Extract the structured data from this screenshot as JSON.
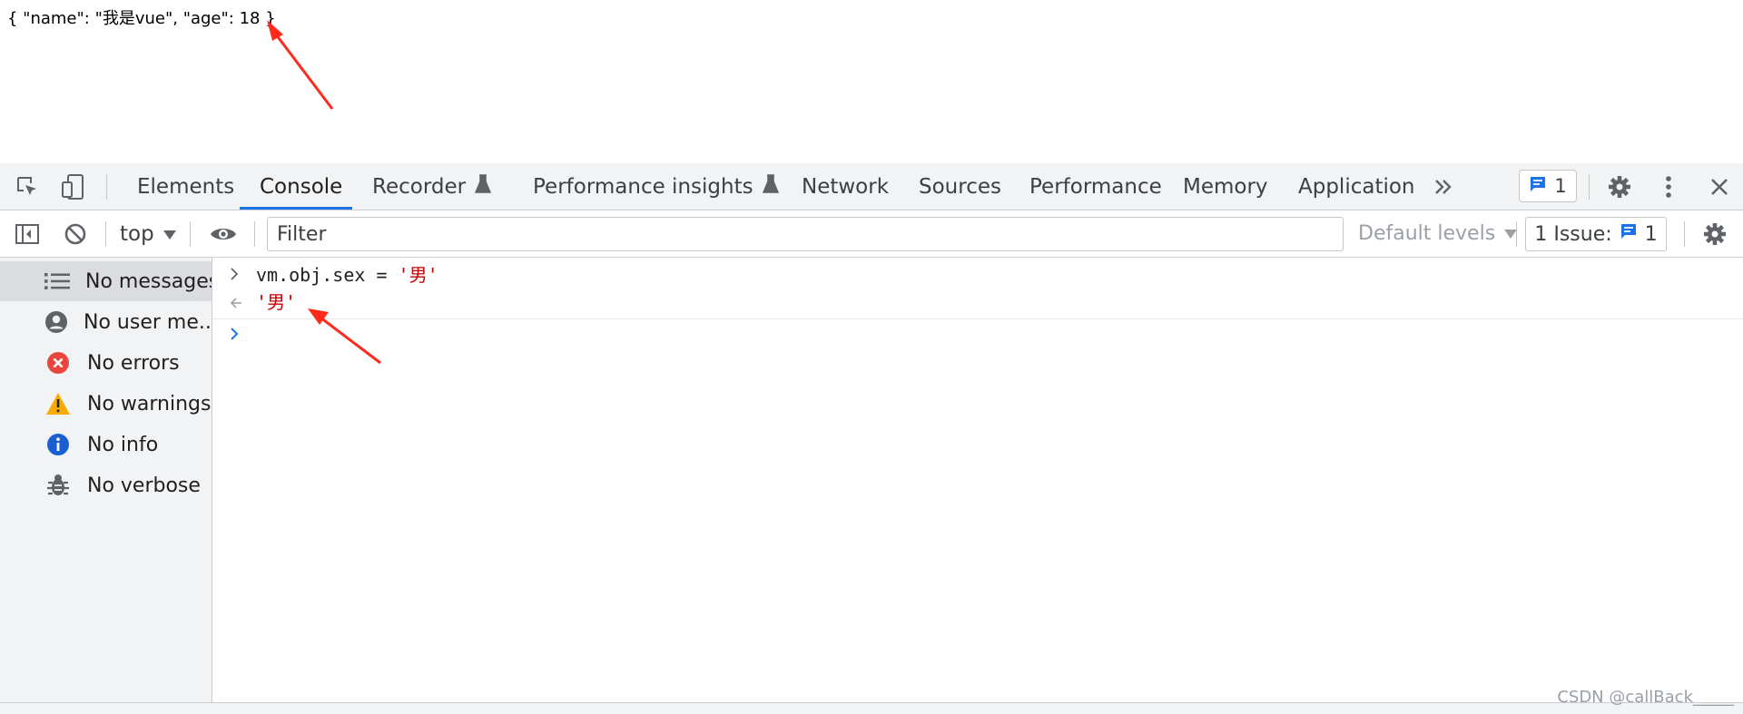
{
  "page": {
    "json_output": "{ \"name\": \"我是vue\", \"age\": 18 }"
  },
  "devtools": {
    "tabs": [
      {
        "label": "Elements"
      },
      {
        "label": "Console",
        "active": true
      },
      {
        "label": "Recorder",
        "experimental": true
      },
      {
        "label": "Performance insights",
        "experimental": true
      },
      {
        "label": "Network"
      },
      {
        "label": "Sources"
      },
      {
        "label": "Performance"
      },
      {
        "label": "Memory"
      },
      {
        "label": "Application"
      }
    ],
    "issues_badge_count": "1",
    "toolbar": {
      "context": "top",
      "filter_placeholder": "Filter",
      "levels": "Default levels",
      "issues_label": "1 Issue:",
      "issues_count": "1"
    },
    "sidebar": {
      "items": [
        {
          "label": "No messages",
          "icon": "list-icon",
          "selected": true
        },
        {
          "label": "No user me...",
          "icon": "user-icon"
        },
        {
          "label": "No errors",
          "icon": "error-icon"
        },
        {
          "label": "No warnings",
          "icon": "warning-icon"
        },
        {
          "label": "No info",
          "icon": "info-icon"
        },
        {
          "label": "No verbose",
          "icon": "bug-icon"
        }
      ]
    },
    "console": {
      "input_code": "vm.obj.sex = ",
      "input_string": "'男'",
      "result_string": "'男'"
    }
  },
  "colors": {
    "accent": "#1a73e8",
    "string": "#c80000",
    "error": "#e8453c",
    "warning": "#f9ab00",
    "info": "#1a5fd0",
    "annotation_arrow": "#ff2a1a"
  },
  "watermark": "CSDN @callBack_____"
}
